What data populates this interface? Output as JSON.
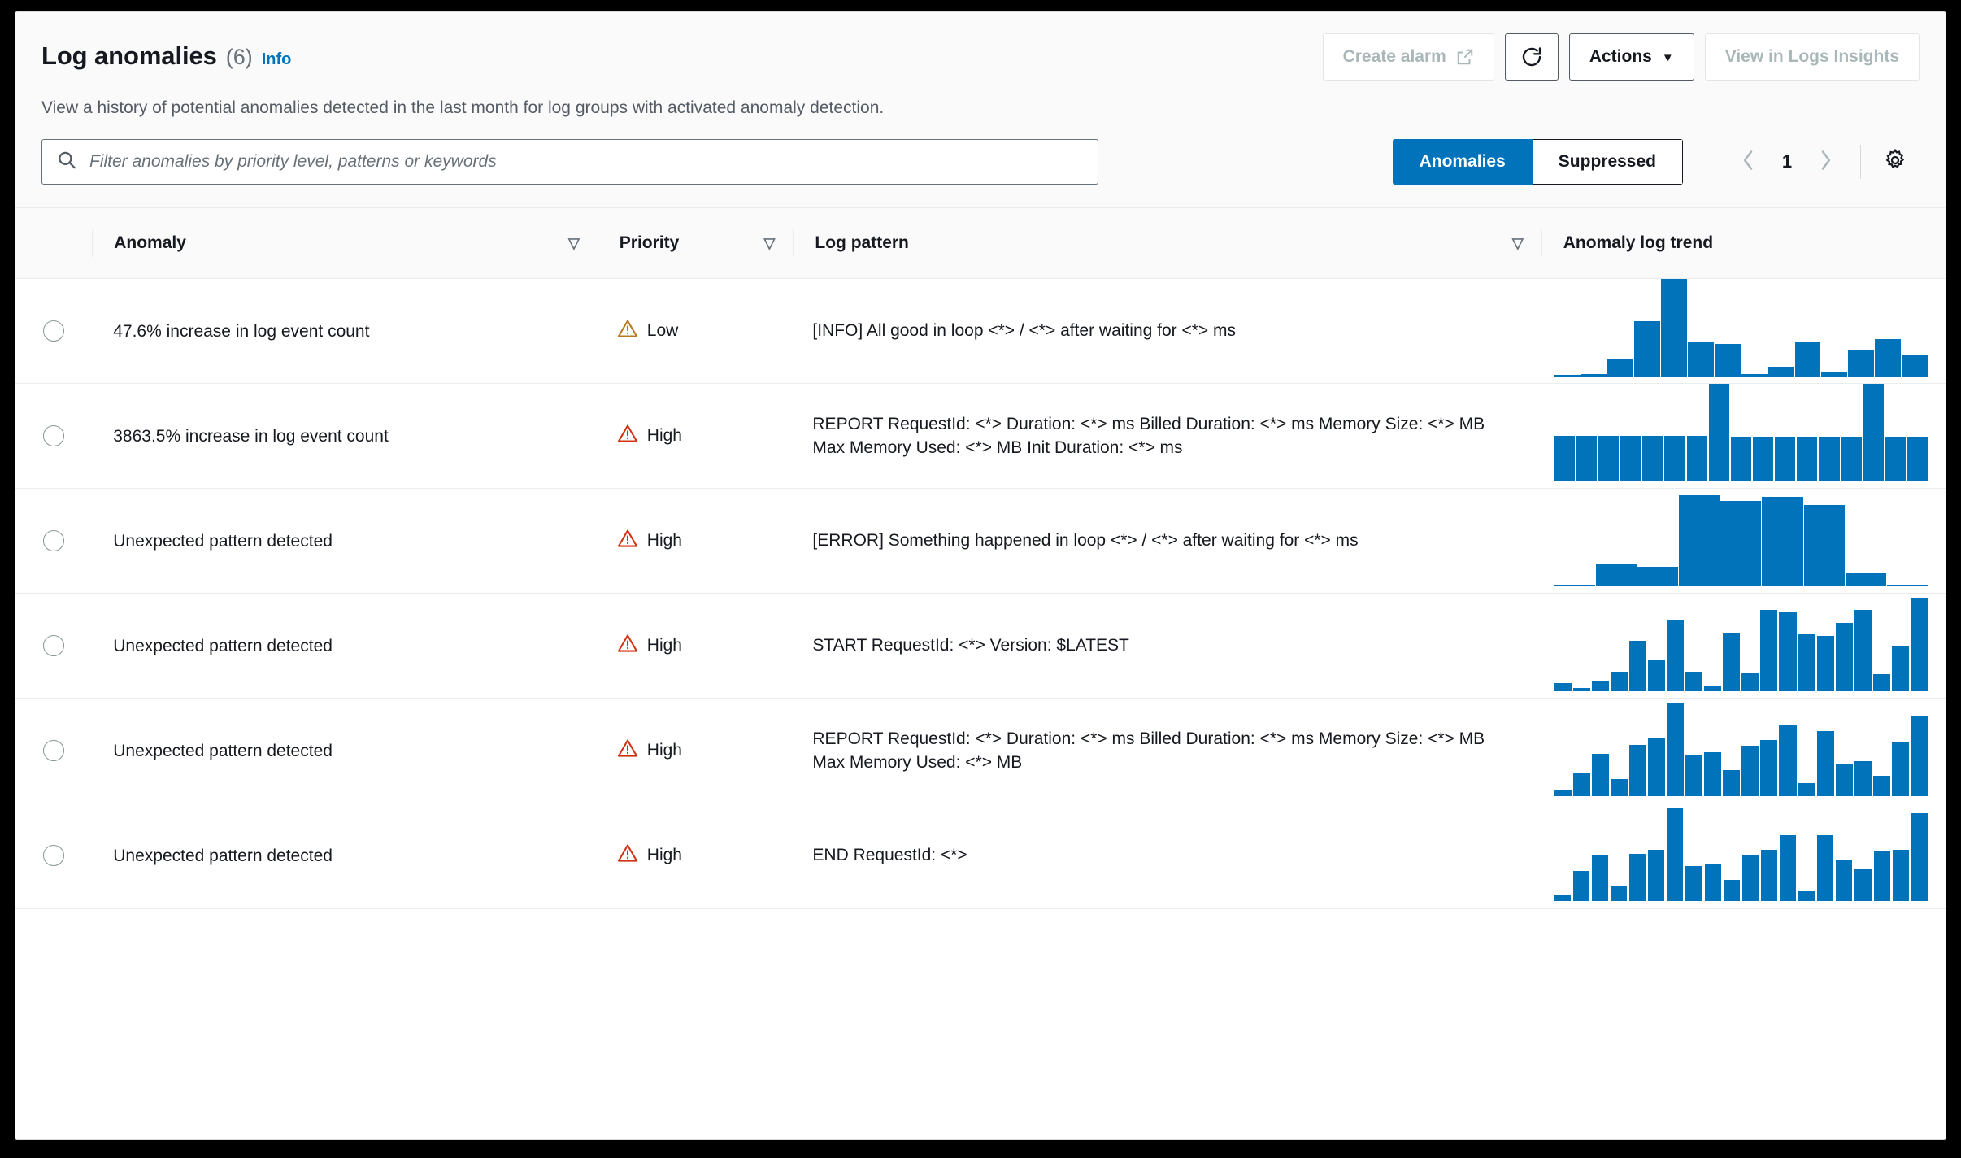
{
  "header": {
    "title": "Log anomalies",
    "count": "(6)",
    "info_label": "Info",
    "description": "View a history of potential anomalies detected in the last month for log groups with activated anomaly detection.",
    "buttons": {
      "create_alarm": "Create alarm",
      "refresh_icon": "refresh-icon",
      "actions": "Actions",
      "actions_caret": "▼",
      "view_in_logs_insights": "View in Logs Insights"
    }
  },
  "filter": {
    "search_placeholder": "Filter anomalies by priority level, patterns or keywords",
    "search_value": "",
    "search_icon": "search-icon",
    "tabs": [
      {
        "label": "Anomalies",
        "active": true
      },
      {
        "label": "Suppressed",
        "active": false
      }
    ],
    "pagination": {
      "prev_icon": "chevron-left-icon",
      "page": "1",
      "next_icon": "chevron-right-icon"
    },
    "settings_icon": "gear-icon"
  },
  "table": {
    "columns": [
      {
        "label": "Anomaly",
        "sortable": true
      },
      {
        "label": "Priority",
        "sortable": true
      },
      {
        "label": "Log pattern",
        "sortable": true
      },
      {
        "label": "Anomaly log trend",
        "sortable": false
      }
    ],
    "sort_glyph": "▽",
    "rows": [
      {
        "anomaly": "47.6% increase in log event count",
        "priority": "Low",
        "priority_color": "#b7791f",
        "log_pattern": "[INFO] All good in loop <*> / <*> after waiting for <*> ms"
      },
      {
        "anomaly": "3863.5% increase in log event count",
        "priority": "High",
        "priority_color": "#d13212",
        "log_pattern": "REPORT RequestId: <*> Duration: <*> ms Billed Duration: <*> ms Memory Size: <*> MB Max Memory Used: <*> MB Init Duration: <*> ms"
      },
      {
        "anomaly": "Unexpected pattern detected",
        "priority": "High",
        "priority_color": "#d13212",
        "log_pattern": "[ERROR] Something happened in loop <*> / <*> after waiting for <*> ms"
      },
      {
        "anomaly": "Unexpected pattern detected",
        "priority": "High",
        "priority_color": "#d13212",
        "log_pattern": "START RequestId: <*> Version: $LATEST"
      },
      {
        "anomaly": "Unexpected pattern detected",
        "priority": "High",
        "priority_color": "#d13212",
        "log_pattern": "REPORT RequestId: <*> Duration: <*> ms Billed Duration: <*> ms Memory Size: <*> MB Max Memory Used: <*> MB"
      },
      {
        "anomaly": "Unexpected pattern detected",
        "priority": "High",
        "priority_color": "#d13212",
        "log_pattern": "END RequestId: <*>"
      }
    ]
  },
  "chart_data": [
    {
      "type": "bar",
      "title": "Anomaly log trend — 47.6% increase in log event count",
      "series_color": "#0073bb",
      "ylim": [
        0,
        100
      ],
      "categories": [
        "1",
        "2",
        "3",
        "4",
        "5",
        "6",
        "7",
        "8",
        "9",
        "10",
        "11",
        "12",
        "13",
        "14"
      ],
      "values": [
        1,
        3,
        19,
        57,
        100,
        35,
        34,
        3,
        10,
        35,
        5,
        28,
        39,
        23
      ]
    },
    {
      "type": "bar",
      "title": "Anomaly log trend — 3863.5% increase in log event count",
      "series_color": "#0073bb",
      "ylim": [
        0,
        100
      ],
      "categories": [
        "1",
        "2",
        "3",
        "4",
        "5",
        "6",
        "7",
        "8",
        "9",
        "10",
        "11",
        "12",
        "13",
        "14",
        "15",
        "16",
        "17"
      ],
      "values": [
        47,
        47,
        47,
        47,
        47,
        47,
        47,
        100,
        46,
        46,
        46,
        46,
        46,
        46,
        100,
        46,
        46
      ]
    },
    {
      "type": "bar",
      "title": "Anomaly log trend — Unexpected pattern detected ([ERROR] Something happened in loop)",
      "series_color": "#0073bb",
      "ylim": [
        0,
        100
      ],
      "categories": [
        "1",
        "2",
        "3",
        "4",
        "5",
        "6",
        "7",
        "8",
        "9"
      ],
      "values": [
        1,
        23,
        20,
        94,
        88,
        92,
        84,
        14,
        2
      ]
    },
    {
      "type": "bar",
      "title": "Anomaly log trend — Unexpected pattern detected (START RequestId)",
      "series_color": "#0073bb",
      "ylim": [
        0,
        100
      ],
      "categories": [
        "1",
        "2",
        "3",
        "4",
        "5",
        "6",
        "7",
        "8",
        "9",
        "10",
        "11",
        "12",
        "13",
        "14",
        "15",
        "16",
        "17",
        "18",
        "19",
        "20"
      ],
      "values": [
        9,
        4,
        10,
        20,
        52,
        33,
        73,
        20,
        6,
        60,
        19,
        84,
        81,
        59,
        57,
        70,
        84,
        18,
        47,
        96
      ]
    },
    {
      "type": "bar",
      "title": "Anomaly log trend — Unexpected pattern detected (REPORT RequestId)",
      "series_color": "#0073bb",
      "ylim": [
        0,
        100
      ],
      "categories": [
        "1",
        "2",
        "3",
        "4",
        "5",
        "6",
        "7",
        "8",
        "9",
        "10",
        "11",
        "12",
        "13",
        "14",
        "15",
        "16",
        "17",
        "18",
        "19",
        "20"
      ],
      "values": [
        7,
        24,
        44,
        18,
        53,
        60,
        95,
        42,
        45,
        27,
        52,
        58,
        74,
        14,
        67,
        33,
        36,
        21,
        55,
        82
      ]
    },
    {
      "type": "bar",
      "title": "Anomaly log trend — Unexpected pattern detected (END RequestId)",
      "series_color": "#0073bb",
      "ylim": [
        0,
        100
      ],
      "categories": [
        "1",
        "2",
        "3",
        "4",
        "5",
        "6",
        "7",
        "8",
        "9",
        "10",
        "11",
        "12",
        "13",
        "14",
        "15",
        "16",
        "17",
        "18",
        "19",
        "20"
      ],
      "values": [
        6,
        31,
        48,
        15,
        49,
        53,
        95,
        36,
        39,
        22,
        47,
        53,
        68,
        10,
        68,
        43,
        33,
        52,
        53,
        90
      ]
    }
  ]
}
